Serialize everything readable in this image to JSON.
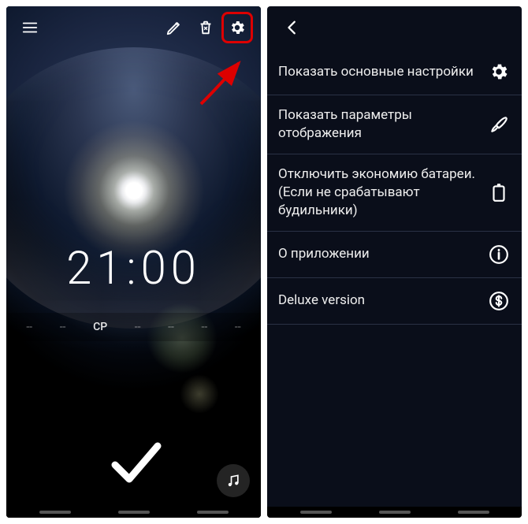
{
  "left": {
    "clock": "21:00",
    "days": [
      {
        "label": "--",
        "active": false
      },
      {
        "label": "--",
        "active": false
      },
      {
        "label": "СР",
        "active": true
      },
      {
        "label": "--",
        "active": false
      },
      {
        "label": "--",
        "active": false
      },
      {
        "label": "--",
        "active": false
      },
      {
        "label": "--",
        "active": false
      }
    ]
  },
  "right": {
    "menu": [
      {
        "label": "Показать основные настройки",
        "icon": "gear"
      },
      {
        "label": "Показать параметры отображения",
        "icon": "brush"
      },
      {
        "label": "Отключить экономию батареи. (Если не срабатывают будильники)",
        "icon": "battery"
      },
      {
        "label": "О приложении",
        "icon": "info"
      },
      {
        "label": "Deluxe version",
        "icon": "dollar"
      }
    ]
  }
}
